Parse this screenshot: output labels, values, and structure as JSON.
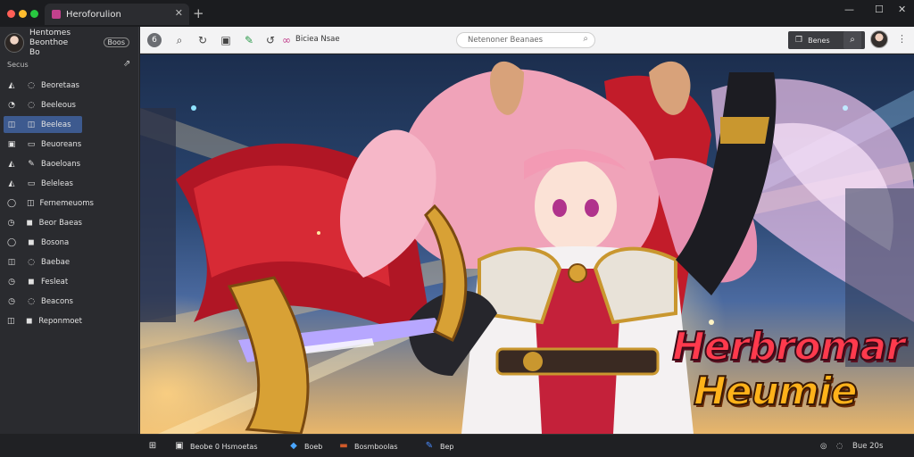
{
  "window": {
    "controls": {
      "minimize": "—",
      "maximize": "☐",
      "close": "✕"
    },
    "traffic_colors": [
      "#ff5f57",
      "#febc2e",
      "#28c840"
    ]
  },
  "tab": {
    "title": "Heroforulion",
    "close": "✕",
    "new_tab": "+"
  },
  "sidebar": {
    "profile": {
      "name_line1": "Hentomes Beonthoe",
      "name_line2": "Bo",
      "button": "Boos"
    },
    "section_label": "Secus",
    "pin": "⇗",
    "items": [
      {
        "icon": "◭",
        "icon2": "◌",
        "label": "Beoretaas"
      },
      {
        "icon": "◔",
        "icon2": "◌",
        "label": "Beeleous"
      },
      {
        "icon": "◫",
        "icon2": "◫",
        "label": "Beeleas",
        "active": true
      },
      {
        "icon": "▣",
        "icon2": "▭",
        "label": "Beuoreans"
      },
      {
        "icon": "◭",
        "icon2": "✎",
        "label": "Baoeloans"
      },
      {
        "icon": "◭",
        "icon2": "▭",
        "label": "Beleleas"
      },
      {
        "icon": "◯",
        "icon2": "◫",
        "label": "Fernemeuoms"
      },
      {
        "icon": "◷",
        "icon2": "◼",
        "label": "Beor Baeas"
      },
      {
        "icon": "◯",
        "icon2": "◼",
        "label": "Bosona"
      },
      {
        "icon": "◫",
        "icon2": "◌",
        "label": "Baebae"
      },
      {
        "icon": "◷",
        "icon2": "◼",
        "label": "Fesleat"
      },
      {
        "icon": "◷",
        "icon2": "◌",
        "label": "Beacons"
      },
      {
        "icon": "◫",
        "icon2": "◼",
        "label": "Reponmoet"
      }
    ]
  },
  "toolbar": {
    "profile_circle": "6",
    "page_label": "Biciea Nsae",
    "address_text": "Netenoner Beanaes",
    "share_label": "Benes",
    "more": "⋮"
  },
  "artwork": {
    "logo_line1": "Herbromar",
    "logo_line2": "Heumie"
  },
  "taskbar": {
    "items": [
      {
        "icon": "⊞",
        "label": ""
      },
      {
        "icon": "▣",
        "label": "Beobe 0 Hsmoetas"
      },
      {
        "icon": "◆",
        "label": "Boeb"
      },
      {
        "icon": "▬",
        "label": "Bosmboolas"
      },
      {
        "icon": "✎",
        "label": "Bep"
      }
    ],
    "tray_text": "Bue 20s",
    "tray_icon1": "◎",
    "tray_icon2": "◌"
  },
  "colors": {
    "sidebar_active": "#3d5a8f",
    "toolbar_bg": "#f3f3f4",
    "logo_red": "#ff3a4d",
    "logo_gold": "#ffb21a"
  }
}
